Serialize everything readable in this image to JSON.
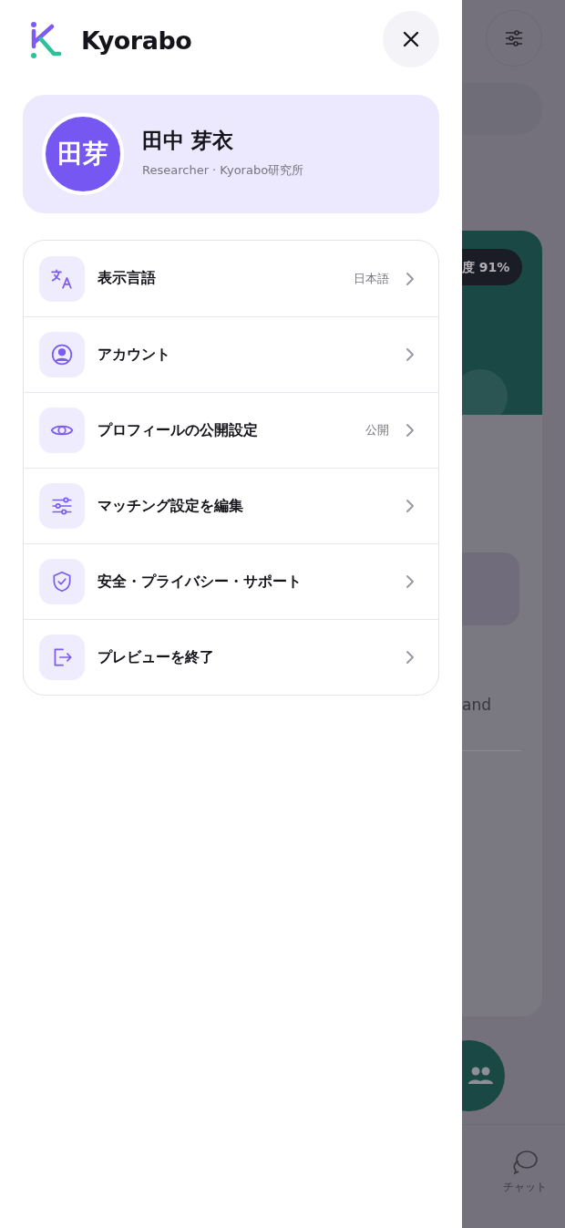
{
  "drawer": {
    "brand": "Kyorabo",
    "profile": {
      "initials": "田芽",
      "name": "田中 芽衣",
      "subtitle": "Researcher · Kyorabo研究所"
    },
    "menu": [
      {
        "label": "表示言語",
        "value": "日本語"
      },
      {
        "label": "アカウント"
      },
      {
        "label": "プロフィールの公開設定",
        "value": "公開"
      },
      {
        "label": "マッチング設定を編集"
      },
      {
        "label": "安全・プライバシー・サポート"
      },
      {
        "label": "プレビューを終了"
      }
    ]
  },
  "background": {
    "match_badge": "度 91%",
    "card_text": "and",
    "bottom_nav": [
      {
        "label": "チャット"
      }
    ]
  }
}
